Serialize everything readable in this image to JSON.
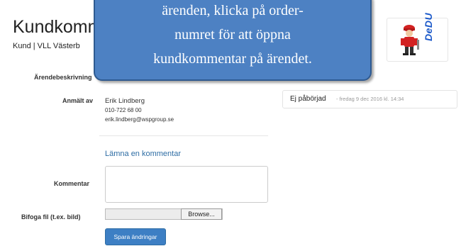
{
  "header": {
    "title": "Kundkomm",
    "subtitle": "Kund | VLL Västerb"
  },
  "logo": {
    "text": "DeDU",
    "icon": "logo-figure-icon"
  },
  "fields": {
    "description_label": "Ärendebeskrivning",
    "reported_by_label": "Anmält av",
    "reporter": {
      "name": "Erik Lindberg",
      "phone": "010-722 68 00",
      "email": "erik.lindberg@wspgroup.se"
    }
  },
  "comment_section": {
    "title": "Lämna en kommentar",
    "comment_label": "Kommentar",
    "comment_value": "",
    "attach_label": "Bifoga fil (t.ex. bild)",
    "browse_label": "Browse...",
    "save_label": "Spara ändringar"
  },
  "status": {
    "text": "Ej påbörjad",
    "date": "- fredag 9 dec 2016 kl. 14:34"
  },
  "tooltip": {
    "lines": [
      "ärenden, klicka på order-",
      "numret för att öppna",
      "kundkommentar på ärendet."
    ]
  }
}
